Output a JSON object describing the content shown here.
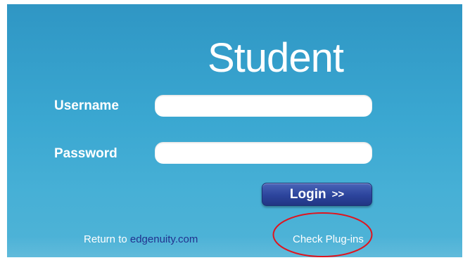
{
  "page": {
    "title": "Student"
  },
  "form": {
    "username_label": "Username",
    "username_value": "",
    "password_label": "Password",
    "password_value": "",
    "login_label": "Login",
    "login_arrows": ">>"
  },
  "footer": {
    "return_prefix": "Return to ",
    "return_link": "edgenuity.com",
    "plugins_label": "Check Plug-ins"
  },
  "annotation": {
    "shape": "ellipse",
    "color": "#e0141e",
    "target": "Check Plug-ins"
  },
  "colors": {
    "background": "#3aa7d1",
    "button": "#2c449c",
    "link": "#1e2e8c"
  }
}
